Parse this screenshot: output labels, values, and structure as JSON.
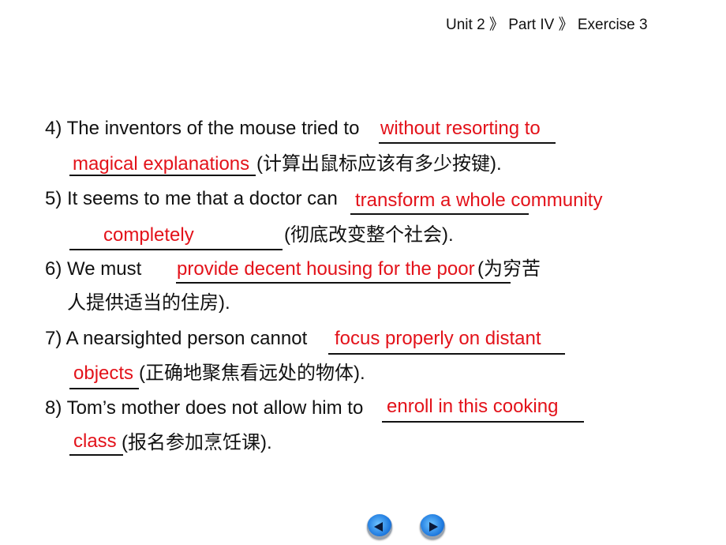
{
  "breadcrumb": {
    "unit": "Unit 2",
    "sep1": "》",
    "part": "Part IV",
    "sep2": "》",
    "exercise": "Exercise 3"
  },
  "items": [
    {
      "q": "4) The inventors of the mouse tried to",
      "cont": "(计算出鼠标应该有多少按键).",
      "ans1": "without resorting to",
      "ans2": "magical explanations"
    },
    {
      "q": "5) It seems to me that a doctor can",
      "cont": "(彻底改变整个社会).",
      "ans1": "transform a whole community",
      "ans2": "completely"
    },
    {
      "q": "6) We must",
      "q_tail": "(为穷苦",
      "cont": "人提供适当的住房).",
      "ans1": "provide decent housing for the poor"
    },
    {
      "q": "7) A nearsighted person cannot",
      "cont": "(正确地聚焦看远处的物体).",
      "ans1": "focus properly on distant",
      "ans2": "objects"
    },
    {
      "q": "8) Tom’s mother does not allow him to",
      "cont": "(报名参加烹饪课).",
      "ans1": "enroll in this cooking",
      "ans2": "class"
    }
  ],
  "nav": {
    "prev": "previous",
    "next": "next"
  }
}
